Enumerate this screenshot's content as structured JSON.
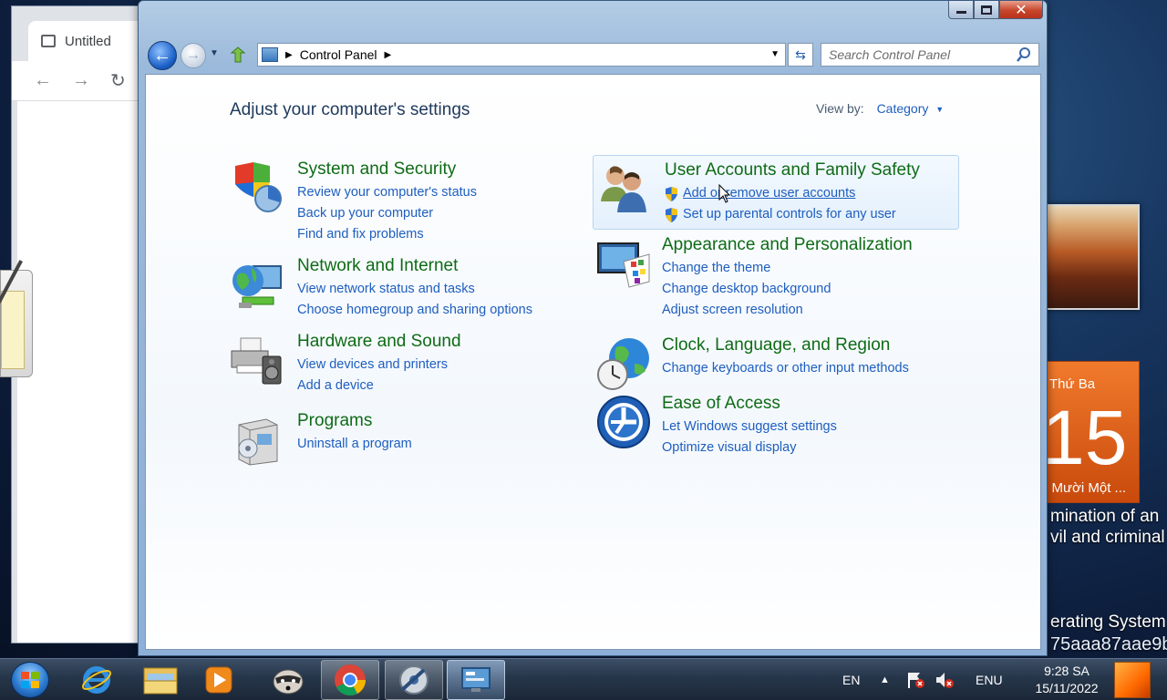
{
  "browser": {
    "tab_title": "Untitled",
    "back_icon": "arrow-left-icon",
    "forward_icon": "arrow-right-icon",
    "reload_icon": "reload-icon"
  },
  "desktop": {
    "calendar": {
      "weekday": "Thứ Ba",
      "day": "15",
      "month": "g Mười Một ..."
    },
    "text_lines": [
      "mination of an",
      "vil and criminal"
    ],
    "os_text": "erating System",
    "hash_text": "75aaa87aae9b"
  },
  "window": {
    "title": "Control Panel",
    "search_placeholder": "Search Control Panel",
    "caption": {
      "minimize": "minimize-icon",
      "maximize": "maximize-icon",
      "close": "✕"
    }
  },
  "main": {
    "heading": "Adjust your computer's settings",
    "view_by_label": "View by:",
    "view_by_value": "Category",
    "categories_left": [
      {
        "title": "System and Security",
        "icon": "shield-chart-icon",
        "links": [
          "Review your computer's status",
          "Back up your computer",
          "Find and fix problems"
        ]
      },
      {
        "title": "Network and Internet",
        "icon": "globe-network-icon",
        "links": [
          "View network status and tasks",
          "Choose homegroup and sharing options"
        ]
      },
      {
        "title": "Hardware and Sound",
        "icon": "printer-speaker-icon",
        "links": [
          "View devices and printers",
          "Add a device"
        ]
      },
      {
        "title": "Programs",
        "icon": "programs-box-icon",
        "links": [
          "Uninstall a program"
        ]
      }
    ],
    "categories_right": [
      {
        "title": "User Accounts and Family Safety",
        "icon": "users-icon",
        "links": [
          "Add or remove user accounts",
          "Set up parental controls for any user"
        ]
      },
      {
        "title": "Appearance and Personalization",
        "icon": "monitor-palette-icon",
        "links": [
          "Change the theme",
          "Change desktop background",
          "Adjust screen resolution"
        ]
      },
      {
        "title": "Clock, Language, and Region",
        "icon": "globe-clock-icon",
        "links": [
          "Change keyboards or other input methods"
        ]
      },
      {
        "title": "Ease of Access",
        "icon": "ease-of-access-icon",
        "links": [
          "Let Windows suggest settings",
          "Optimize visual display"
        ]
      }
    ]
  },
  "taskbar": {
    "items": [
      "internet-explorer-icon",
      "folder-icon",
      "media-player-icon",
      "raccoon-app-icon",
      "chrome-icon",
      "media-center-icon",
      "control-panel-icon"
    ],
    "tray": {
      "lang_short": "EN",
      "lang_long": "ENU",
      "time": "9:28 SA",
      "date": "15/11/2022"
    }
  }
}
